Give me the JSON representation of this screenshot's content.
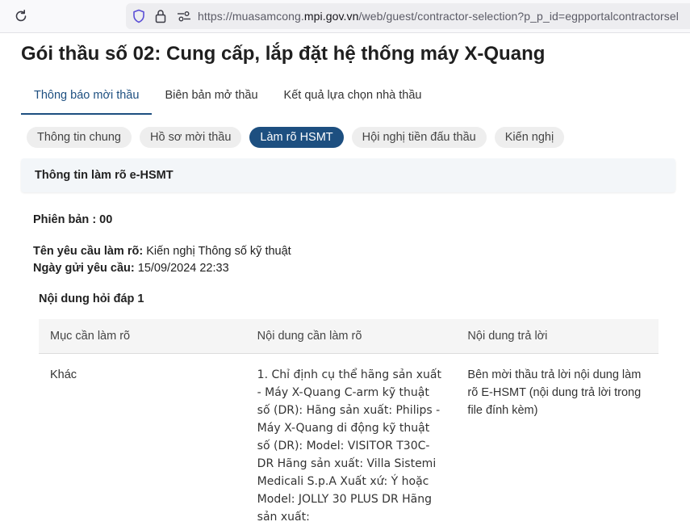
{
  "browser": {
    "url_prefix": "https://muasamcong.",
    "url_domain": "mpi.gov.vn",
    "url_suffix": "/web/guest/contractor-selection?p_p_id=egpportalcontractorsel"
  },
  "page": {
    "title": "Gói thầu số 02: Cung cấp, lắp đặt hệ thống máy X-Quang"
  },
  "main_tabs": [
    {
      "label": "Thông báo mời thầu"
    },
    {
      "label": "Biên bản mở thầu"
    },
    {
      "label": "Kết quả lựa chọn nhà thầu"
    }
  ],
  "sub_tabs": [
    {
      "label": "Thông tin chung"
    },
    {
      "label": "Hồ sơ mời thầu"
    },
    {
      "label": "Làm rõ HSMT"
    },
    {
      "label": "Hội nghị tiền đấu thầu"
    },
    {
      "label": "Kiến nghị"
    }
  ],
  "section": {
    "title": "Thông tin làm rõ e-HSMT"
  },
  "details": {
    "version": "Phiên bản : 00",
    "request_name_label": "Tên yêu cầu làm rõ:",
    "request_name_value": "Kiến nghị Thông số kỹ thuật",
    "send_date_label": "Ngày gửi yêu cầu:",
    "send_date_value": "15/09/2024 22:33"
  },
  "qa": {
    "title": "Nội dung hỏi đáp 1",
    "headers": [
      "Mục cần làm rõ",
      "Nội dung cần làm rõ",
      "Nội dung trả lời"
    ],
    "rows": [
      {
        "item": "Khác",
        "question": "1. Chỉ định cụ thể hãng sản xuất - Máy X-Quang C-arm kỹ thuật số (DR): Hãng sản xuất: Philips - Máy X-Quang di động kỹ thuật số (DR): Model: VISITOR T30C-DR Hãng sản xuất: Villa Sistemi Medicali S.p.A Xuất xứ: Ý hoặc Model: JOLLY 30 PLUS DR Hãng sản xuất:",
        "answer": "Bên mời thầu trả lời nội dung làm rõ E-HSMT (nội dung trả lời trong file đính kèm)"
      }
    ]
  }
}
